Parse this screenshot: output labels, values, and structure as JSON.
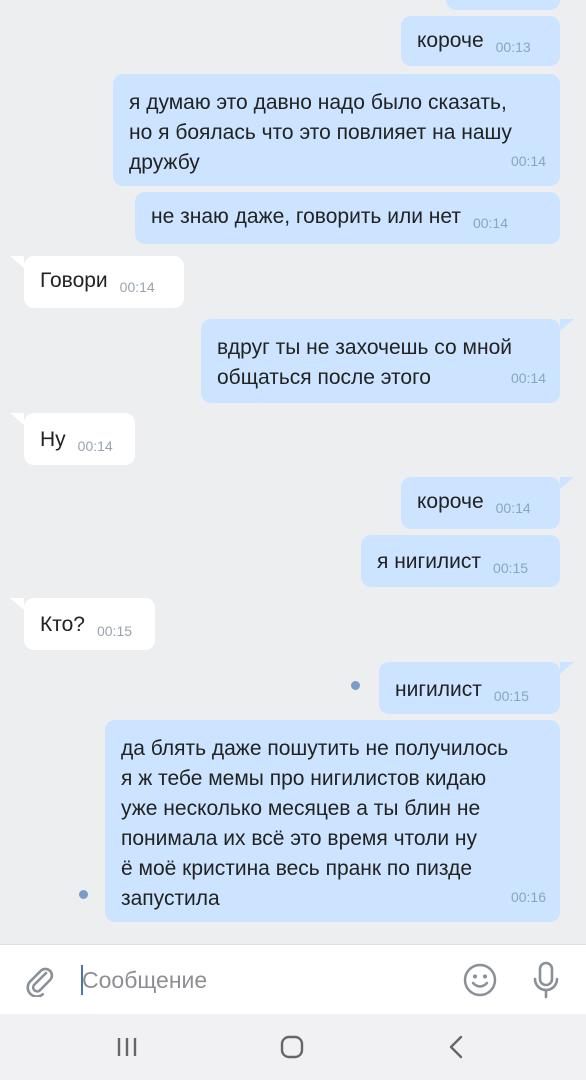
{
  "messages": [
    {
      "dir": "out",
      "text": "короче",
      "time": "00:13"
    },
    {
      "dir": "out",
      "text": "я думаю это давно надо было сказать,\nно я боялась что это повлияет на нашу\nдружбу",
      "time": "00:14"
    },
    {
      "dir": "out",
      "text": "не знаю даже, говорить или нет",
      "time": "00:14"
    },
    {
      "dir": "in",
      "text": "Говори",
      "time": "00:14"
    },
    {
      "dir": "out",
      "text": "вдруг ты не захочешь со мной\nобщаться после этого",
      "time": "00:14"
    },
    {
      "dir": "in",
      "text": "Ну",
      "time": "00:14"
    },
    {
      "dir": "out",
      "text": "короче",
      "time": "00:14"
    },
    {
      "dir": "out",
      "text": "я нигилист",
      "time": "00:15"
    },
    {
      "dir": "in",
      "text": "Кто?",
      "time": "00:15"
    },
    {
      "dir": "out",
      "text": "нигилист",
      "time": "00:15"
    },
    {
      "dir": "out",
      "text": "да блять даже пошутить не получилось\nя ж тебе мемы про нигилистов кидаю\nуже несколько месяцев а ты блин не\nпонимала их всё это время чтоли ну\nё моё кристина весь пранк по пизде\nзапустила",
      "time": "00:16"
    }
  ],
  "composer": {
    "placeholder": "Сообщение",
    "attach_icon": "paperclip-icon",
    "emoji_icon": "smiley-icon",
    "mic_icon": "microphone-icon"
  },
  "navbar": {
    "recent_icon": "recent-apps-icon",
    "home_icon": "home-icon",
    "back_icon": "back-icon"
  },
  "colors": {
    "background": "#edeef0",
    "outgoing_bubble": "#cce4ff",
    "incoming_bubble": "#ffffff",
    "unread_dot": "#7a9cc6"
  }
}
